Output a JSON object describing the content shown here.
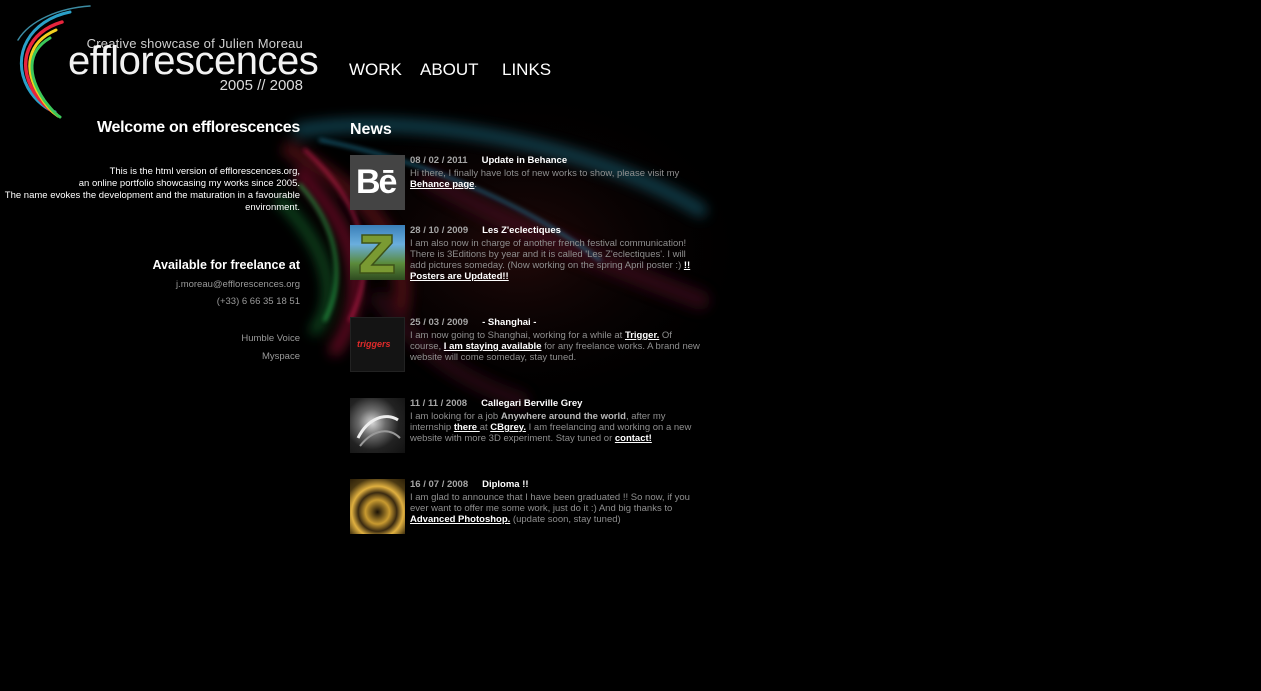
{
  "logo": {
    "tagline": "Creative showcase of Julien Moreau",
    "title": "efflorescences",
    "years": "2005 // 2008"
  },
  "nav": {
    "work": "WORK",
    "about": "ABOUT",
    "links": "LINKS"
  },
  "left": {
    "welcome": "Welcome on efflorescences",
    "intro": "This is the html version of efflorescences.org,\nan online portfolio showcasing my works since 2005.\nThe name evokes the development and the maturation in a favourable environment.",
    "available": "Available for freelance at",
    "email": "j.moreau@efflorescences.org",
    "phone": "(+33) 6 66 35 18 51",
    "link1": "Humble Voice",
    "link2": "Myspace"
  },
  "news": {
    "title": "News",
    "items": [
      {
        "date": "08 / 02 / 2011",
        "title": "Update in Behance",
        "p1": "Hi there, I finally have lots of new works to show, please visit my ",
        "link1": "Behance page",
        "p2": "."
      },
      {
        "date": "28 / 10 / 2009",
        "title": "Les Z'eclectiques",
        "p1": "I am also now in charge of another french festival communication! There is 3Editions by year and it is called 'Les Z'eclectiques'. I will add pictures someday. (Now working on the spring April poster :) ",
        "link1": "!! Posters are Updated!!"
      },
      {
        "date": "25 / 03 / 2009",
        "title": "- Shanghai -",
        "p1": "I am now going to Shanghai, working for a while at ",
        "link1": "Trigger.",
        "p2": " Of course, ",
        "link2": "I am staying available",
        "p3": " for any freelance works. A brand new website will come someday, stay tuned."
      },
      {
        "date": "11 / 11 / 2008",
        "title": "Callegari Berville Grey",
        "p1": "I am looking for a job ",
        "bold1": "Anywhere around the world",
        "p2": ", after my internship ",
        "link1": "there ",
        "p3": "at ",
        "link2": "CBgrey.",
        "p4": " I am freelancing and working on a new website with more 3D experiment. Stay tuned or ",
        "link3": "contact!"
      },
      {
        "date": "16 / 07 / 2008",
        "title": "Diploma !!",
        "p1": "I am glad to announce that I have been graduated !! So now, if you ever want to offer me some work, just do it :) And big thanks to ",
        "link1": "Advanced Photoshop.",
        "p2": " (update soon, stay tuned)"
      }
    ]
  },
  "thumbs": {
    "behance_text": "Bē",
    "trigger_text": "triggers"
  },
  "colors": {
    "background": "#000000",
    "link": "#ffffff",
    "muted": "#8f8f8f",
    "accent_green": "#3cc85a",
    "accent_red": "#d2283c",
    "accent_cyan": "#28a8c8"
  }
}
